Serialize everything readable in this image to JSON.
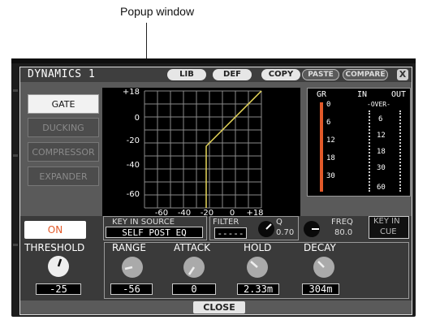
{
  "annotation": {
    "label": "Popup window"
  },
  "window": {
    "title": "DYNAMICS 1",
    "buttons": {
      "lib": "LIB",
      "def": "DEF",
      "copy": "COPY",
      "paste": "PASTE",
      "compare": "COMPARE",
      "close_x": "X"
    }
  },
  "types": [
    "GATE",
    "DUCKING",
    "COMPRESSOR",
    "EXPANDER"
  ],
  "graph": {
    "y_ticks": [
      "+18",
      "0",
      "-20",
      "-40",
      "-60"
    ],
    "x_ticks": [
      "-60",
      "-40",
      "-20",
      "0",
      "+18"
    ]
  },
  "meter": {
    "gr_label": "GR",
    "in_label": "IN",
    "out_label": "OUT",
    "over_label": "-OVER-",
    "gr_scale": [
      "0",
      "6",
      "12",
      "18",
      "30"
    ],
    "io_scale": [
      "6",
      "12",
      "18",
      "30",
      "60"
    ],
    "gr_level": 1.0
  },
  "controls": {
    "on_label": "ON",
    "key_in_source": {
      "label": "KEY IN SOURCE",
      "value": "SELF POST EQ"
    },
    "filter": {
      "label": "FILTER",
      "value": "-----"
    },
    "q": {
      "label": "Q",
      "value": "0.70"
    },
    "freq": {
      "label": "FREQ",
      "value": "80.0"
    },
    "key_in_cue": {
      "line1": "KEY IN",
      "line2": "CUE"
    }
  },
  "params": {
    "threshold": {
      "label": "THRESHOLD",
      "value": "-25"
    },
    "range": {
      "label": "RANGE",
      "value": "-56"
    },
    "attack": {
      "label": "ATTACK",
      "value": "0"
    },
    "hold": {
      "label": "HOLD",
      "value": "2.33m"
    },
    "decay": {
      "label": "DECAY",
      "value": "304m"
    }
  },
  "footer": {
    "close_label": "CLOSE"
  },
  "colors": {
    "accent_orange": "#e25a2a",
    "curve": "#e8d85a",
    "grid": "#8a8a8a"
  }
}
